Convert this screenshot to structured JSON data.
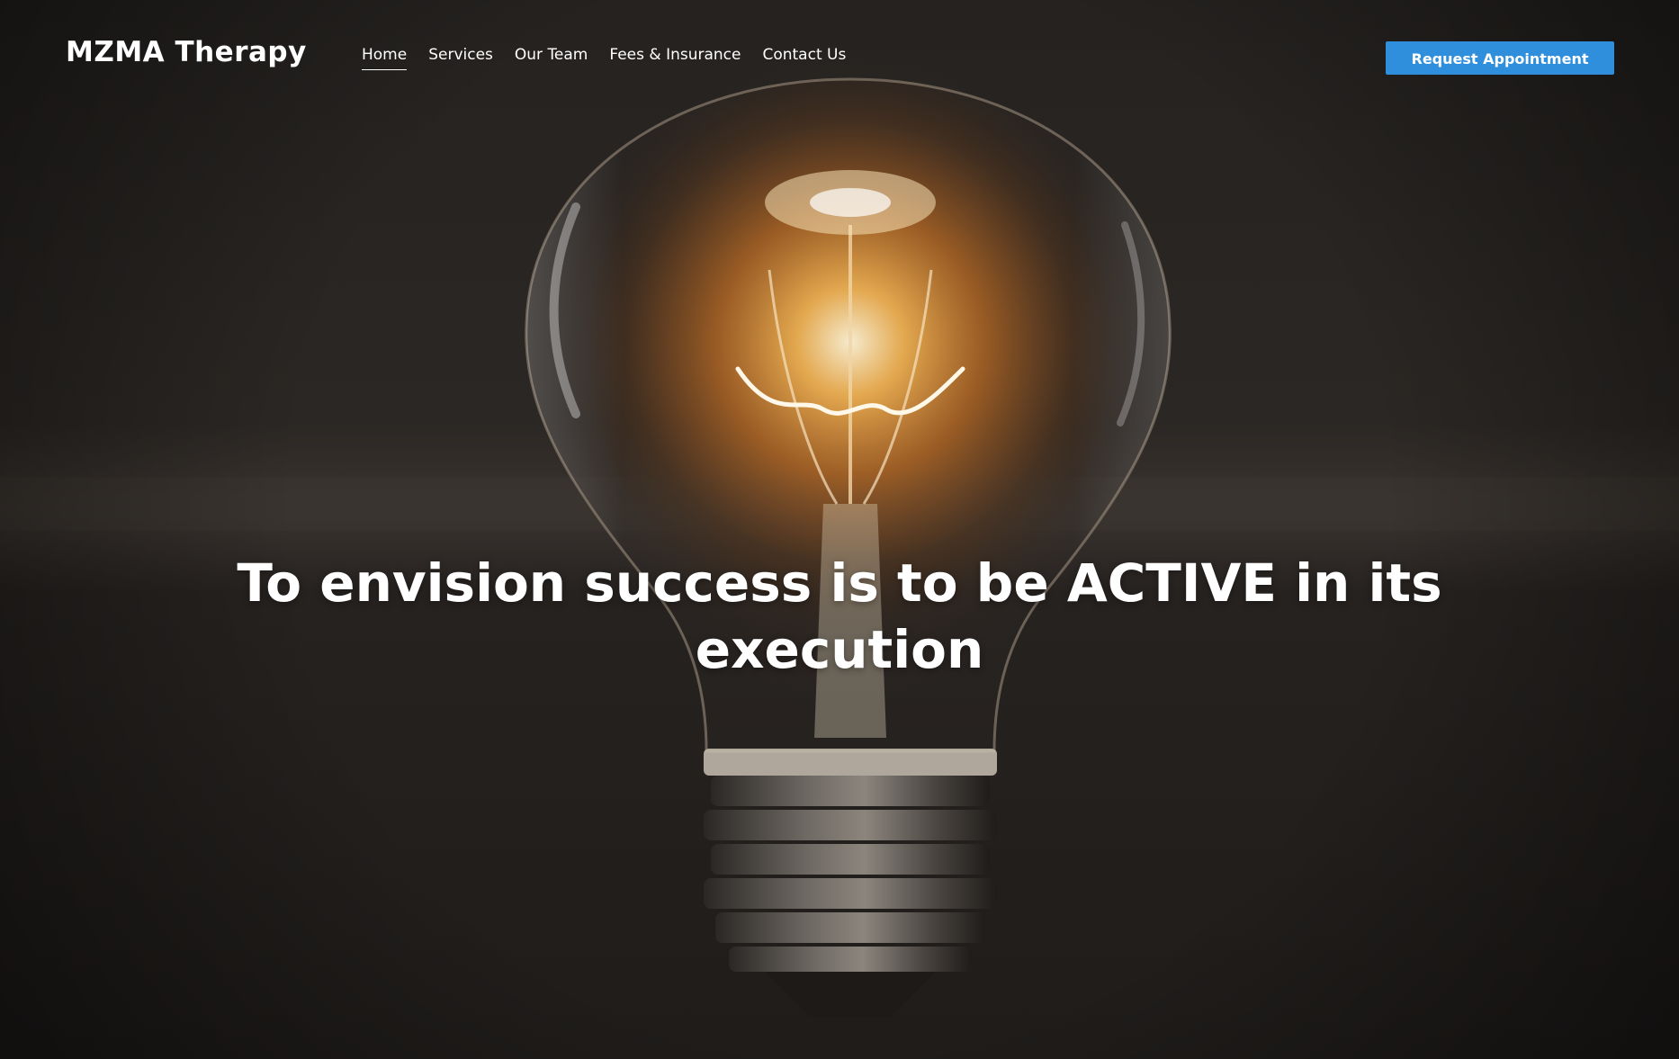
{
  "site": {
    "logo": "MZMA Therapy"
  },
  "nav": {
    "items": [
      {
        "label": "Home",
        "active": true
      },
      {
        "label": "Services",
        "active": false
      },
      {
        "label": "Our Team",
        "active": false
      },
      {
        "label": "Fees & Insurance",
        "active": false
      },
      {
        "label": "Contact Us",
        "active": false
      }
    ]
  },
  "header": {
    "cta_label": "Request Appointment"
  },
  "hero": {
    "headline": "To envision success is to be ACTIVE in its execution",
    "image": "lightbulb-photo"
  },
  "colors": {
    "accent": "#2f8fdc",
    "text": "#ffffff",
    "background": "#231f1d"
  }
}
